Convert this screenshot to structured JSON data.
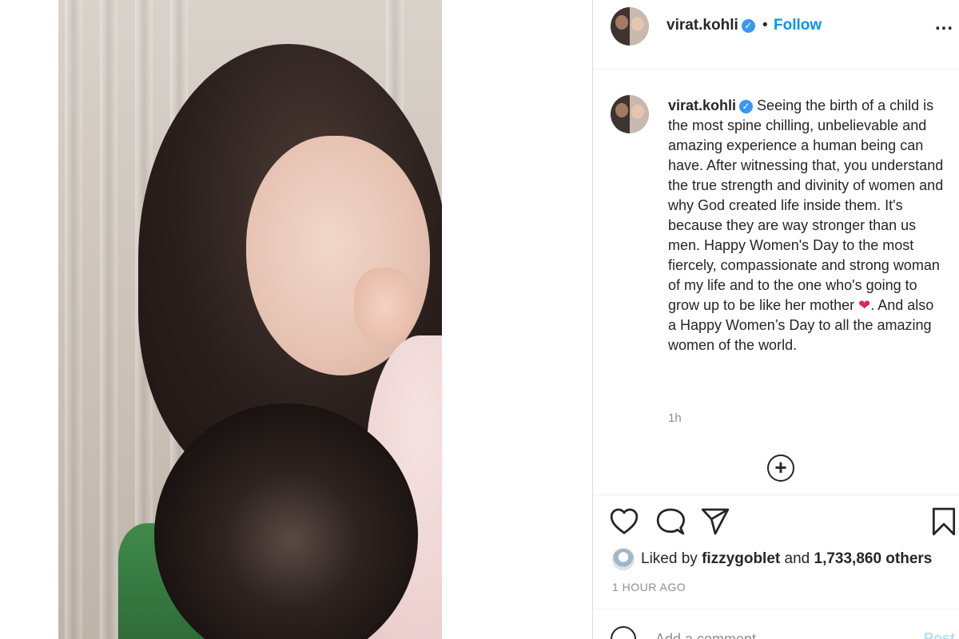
{
  "post": {
    "username": "virat.kohli",
    "verified_symbol": "✓",
    "separator": "•",
    "follow_label": "Follow",
    "more_label": "...",
    "caption_text_1": "Seeing the birth of a child is the most spine chilling, unbelievable and amazing experience a human being can have. After witnessing that, you understand the true strength and divinity of women and why God created life inside them. It's because they are way stronger than us men. Happy Women's Day to the most fiercely, compassionate and strong woman of my life and to the one who's going to grow up to be like her mother ",
    "caption_emoji": "❤",
    "caption_text_2": ". And also a Happy Women’s Day to all the amazing women of the world.",
    "caption_time": "1h",
    "load_more_symbol": "+"
  },
  "likes": {
    "prefix": "Liked by",
    "liker": "fizzygoblet",
    "connector": "and",
    "others": "1,733,860 others"
  },
  "timestamp": "1 HOUR AGO",
  "comment_box": {
    "placeholder": "Add a comment...",
    "post_label": "Post"
  },
  "icons": {
    "like": "heart-icon",
    "comment": "comment-icon",
    "share": "paper-plane-icon",
    "save": "bookmark-icon",
    "emoji": "emoji-icon"
  },
  "colors": {
    "follow": "#0095f6",
    "verified": "#3897f0",
    "muted": "#8e8e8e",
    "post_disabled": "#b2dffc"
  }
}
